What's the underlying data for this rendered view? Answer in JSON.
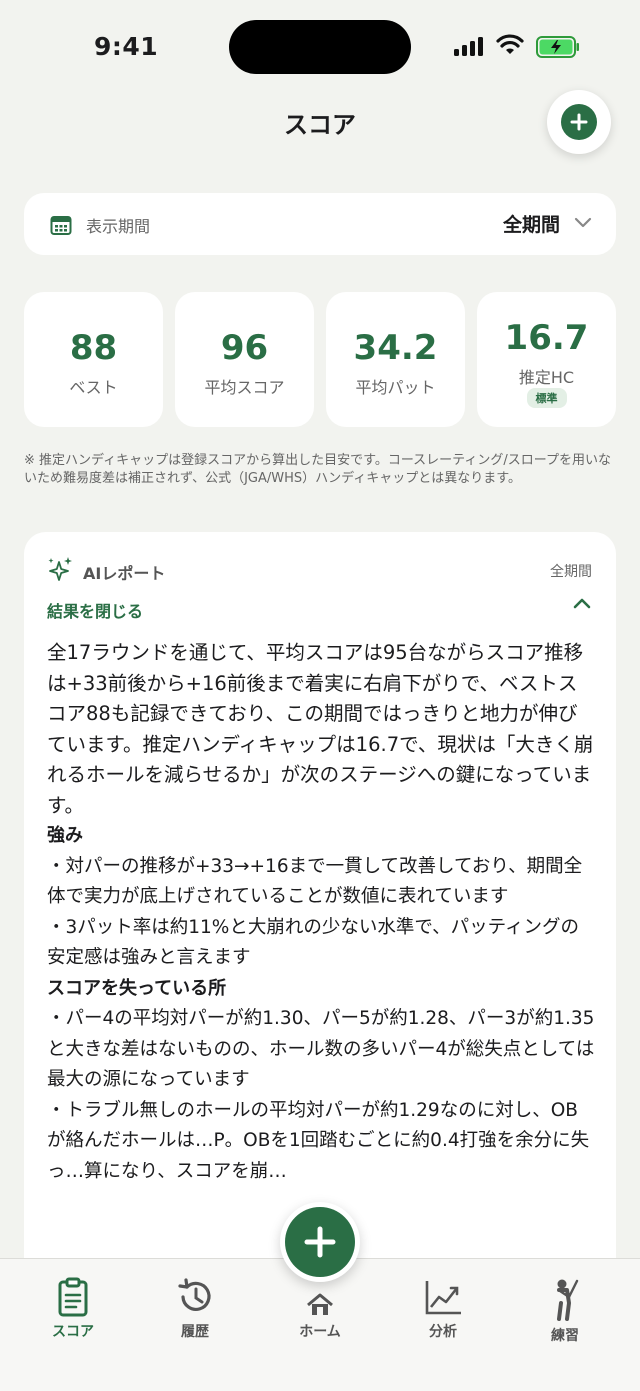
{
  "status_bar": {
    "time": "9:41"
  },
  "header": {
    "title": "スコア"
  },
  "period_selector": {
    "label": "表示期間",
    "value": "全期間"
  },
  "stats": [
    {
      "value": "88",
      "label": "ベスト"
    },
    {
      "value": "96",
      "label": "平均スコア"
    },
    {
      "value": "34.2",
      "label": "平均パット"
    },
    {
      "value": "16.7",
      "label": "推定HC",
      "badge": "標準"
    }
  ],
  "disclaimer": "※ 推定ハンディキャップは登録スコアから算出した目安です。コースレーティング/スロープを用いないため難易度差は補正されず、公式（JGA/WHS）ハンディキャップとは異なります。",
  "ai_report": {
    "title": "AIレポート",
    "period": "全期間",
    "collapse_label": "結果を閉じる",
    "summary": "全17ラウンドを通じて、平均スコアは95台ながらスコア推移は+33前後から+16前後まで着実に右肩下がりで、ベストスコア88も記録できており、この期間ではっきりと地力が伸びています。推定ハンディキャップは16.7で、現状は「大きく崩れるホールを減らせるか」が次のステージへの鍵になっています。",
    "strengths_title": "強み",
    "strengths": [
      "・対パーの推移が+33→+16まで一貫して改善しており、期間全体で実力が底上げされていることが数値に表れています",
      "・3パット率は約11%と大崩れの少ない水準で、パッティングの安定感は強みと言えます"
    ],
    "losses_title": "スコアを失っている所",
    "losses": [
      "・パー4の平均対パーが約1.30、パー5が約1.28、パー3が約1.35と大きな差はないものの、ホール数の多いパー4が総失点としては最大の源になっています",
      "・トラブル無しのホールの平均対パーが約1.29なのに対し、OBが絡んだホールは…P。OBを1回踏むごとに約0.4打強を余分に失っ…算になり、スコアを崩…"
    ]
  },
  "tab_bar": {
    "tabs": [
      {
        "label": "スコア",
        "icon": "clipboard-icon"
      },
      {
        "label": "履歴",
        "icon": "history-icon"
      },
      {
        "label": "ホーム",
        "icon": "home-icon"
      },
      {
        "label": "分析",
        "icon": "chart-icon"
      },
      {
        "label": "練習",
        "icon": "golfer-icon"
      }
    ],
    "active": "スコア"
  },
  "colors": {
    "accent": "#2a6e45",
    "background": "#f2f3ef",
    "card": "#ffffff"
  }
}
